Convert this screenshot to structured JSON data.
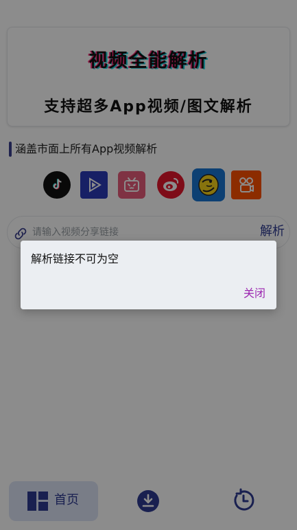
{
  "header": {
    "title": "视频全能解析",
    "subtitle": "支持超多App视频/图文解析"
  },
  "section": {
    "title": "涵盖市面上所有App视频解析"
  },
  "platforms": [
    {
      "name": "tiktok-icon",
      "color": "#111111"
    },
    {
      "name": "video-play-icon",
      "color": "#2b3bb9"
    },
    {
      "name": "bilibili-icon",
      "color": "#e85b7b"
    },
    {
      "name": "weibo-icon",
      "color": "#e6162d"
    },
    {
      "name": "pipixia-icon",
      "color": "#1976d2"
    },
    {
      "name": "kuaishou-icon",
      "color": "#ff5000"
    }
  ],
  "search": {
    "placeholder": "请输入视频分享链接",
    "value": "",
    "button_label": "解析"
  },
  "nav": {
    "home_label": "首页",
    "active": "home",
    "accent": "#2f3b93"
  },
  "dialog": {
    "message": "解析链接不可为空",
    "close_label": "关闭",
    "close_color": "#9c27b0"
  }
}
